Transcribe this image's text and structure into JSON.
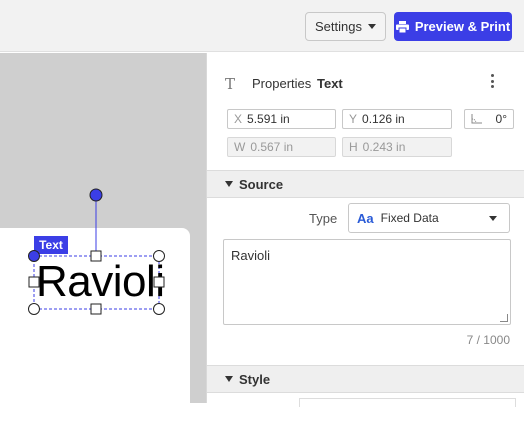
{
  "toolbar": {
    "settings_label": "Settings",
    "print_label": "Preview & Print"
  },
  "canvas": {
    "element_badge": "Text",
    "element_text": "Ravioli"
  },
  "properties": {
    "title": "Properties",
    "element_type": "Text",
    "x": {
      "label": "X",
      "value": "5.591 in"
    },
    "y": {
      "label": "Y",
      "value": "0.126 in"
    },
    "rotation": "0°",
    "w": {
      "label": "W",
      "value": "0.567 in"
    },
    "h": {
      "label": "H",
      "value": "0.243 in"
    }
  },
  "source": {
    "title": "Source",
    "type_label": "Type",
    "type_icon": "Aa",
    "type_value": "Fixed Data",
    "text_value": "Ravioli",
    "counter": "7 / 1000"
  },
  "style": {
    "title": "Style"
  },
  "colors": {
    "accent": "#3b3ee6",
    "selection": "#3b3ee6"
  }
}
